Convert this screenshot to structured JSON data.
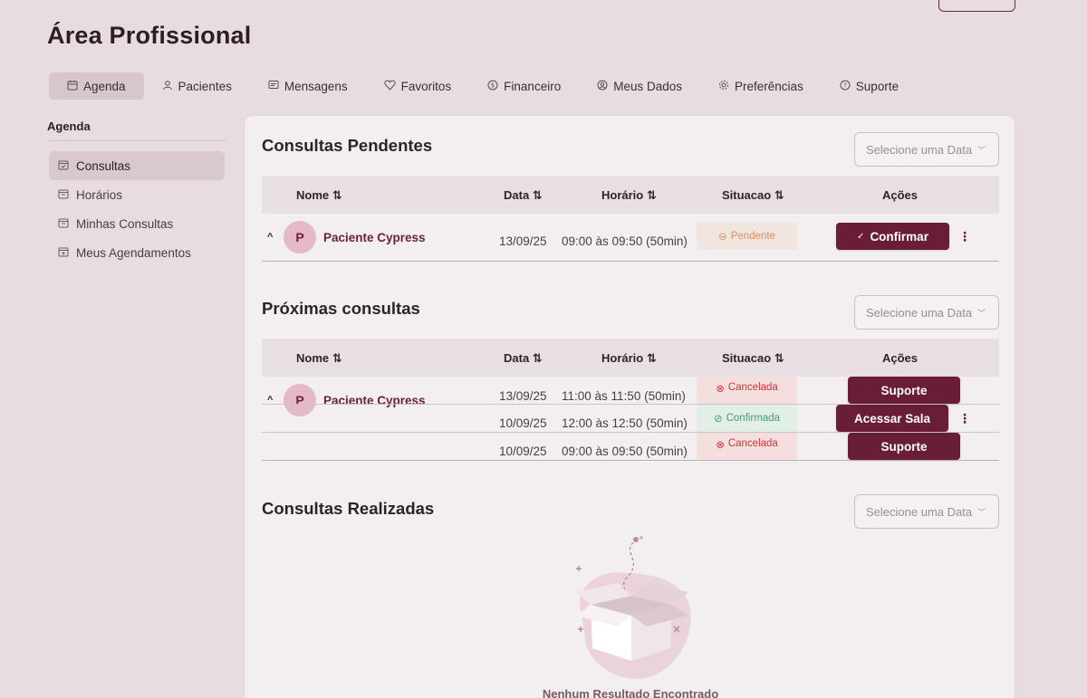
{
  "page": {
    "title": "Área Profissional"
  },
  "nav": [
    {
      "label": "Agenda",
      "icon": "calendar-icon",
      "active": true
    },
    {
      "label": "Pacientes",
      "icon": "user-icon",
      "active": false
    },
    {
      "label": "Mensagens",
      "icon": "message-icon",
      "active": false
    },
    {
      "label": "Favoritos",
      "icon": "heart-icon",
      "active": false
    },
    {
      "label": "Financeiro",
      "icon": "dollar-icon",
      "active": false
    },
    {
      "label": "Meus Dados",
      "icon": "user-circle-icon",
      "active": false
    },
    {
      "label": "Preferências",
      "icon": "gear-icon",
      "active": false
    },
    {
      "label": "Suporte",
      "icon": "help-icon",
      "active": false
    }
  ],
  "sidebar": {
    "title": "Agenda",
    "items": [
      {
        "label": "Consultas",
        "icon": "calendar-check-icon",
        "active": true
      },
      {
        "label": "Horários",
        "icon": "calendar-icon",
        "active": false
      },
      {
        "label": "Minhas Consultas",
        "icon": "calendar-icon",
        "active": false
      },
      {
        "label": "Meus Agendamentos",
        "icon": "calendar-plus-icon",
        "active": false
      }
    ]
  },
  "table_headers": {
    "name": "Nome ⇅",
    "date": "Data ⇅",
    "time": "Horário ⇅",
    "status": "Situacao ⇅",
    "actions": "Ações"
  },
  "date_select_placeholder": "Selecione uma Data",
  "pending": {
    "title": "Consultas Pendentes",
    "rows": [
      {
        "avatar": "P",
        "patient": "Paciente Cypress",
        "date": "13/09/25",
        "time": "09:00 às 09:50 (50min)",
        "status": "Pendente",
        "action": "Confirmar"
      }
    ]
  },
  "upcoming": {
    "title": "Próximas consultas",
    "avatar": "P",
    "patient": "Paciente Cypress",
    "rows": [
      {
        "date": "13/09/25",
        "time": "11:00 às 11:50 (50min)",
        "status": "Cancelada",
        "action": "Suporte"
      },
      {
        "date": "10/09/25",
        "time": "12:00 às 12:50 (50min)",
        "status": "Confirmada",
        "action": "Acessar Sala"
      },
      {
        "date": "10/09/25",
        "time": "09:00 às 09:50 (50min)",
        "status": "Cancelada",
        "action": "Suporte"
      }
    ]
  },
  "done": {
    "title": "Consultas Realizadas",
    "empty_text": "Nenhum Resultado Encontrado"
  },
  "colors": {
    "primary": "#6a1d36",
    "background": "#e7dde1",
    "card": "#f3eff1",
    "pending": "#e08a5c",
    "cancel": "#d23434",
    "confirm": "#3aa36a"
  }
}
